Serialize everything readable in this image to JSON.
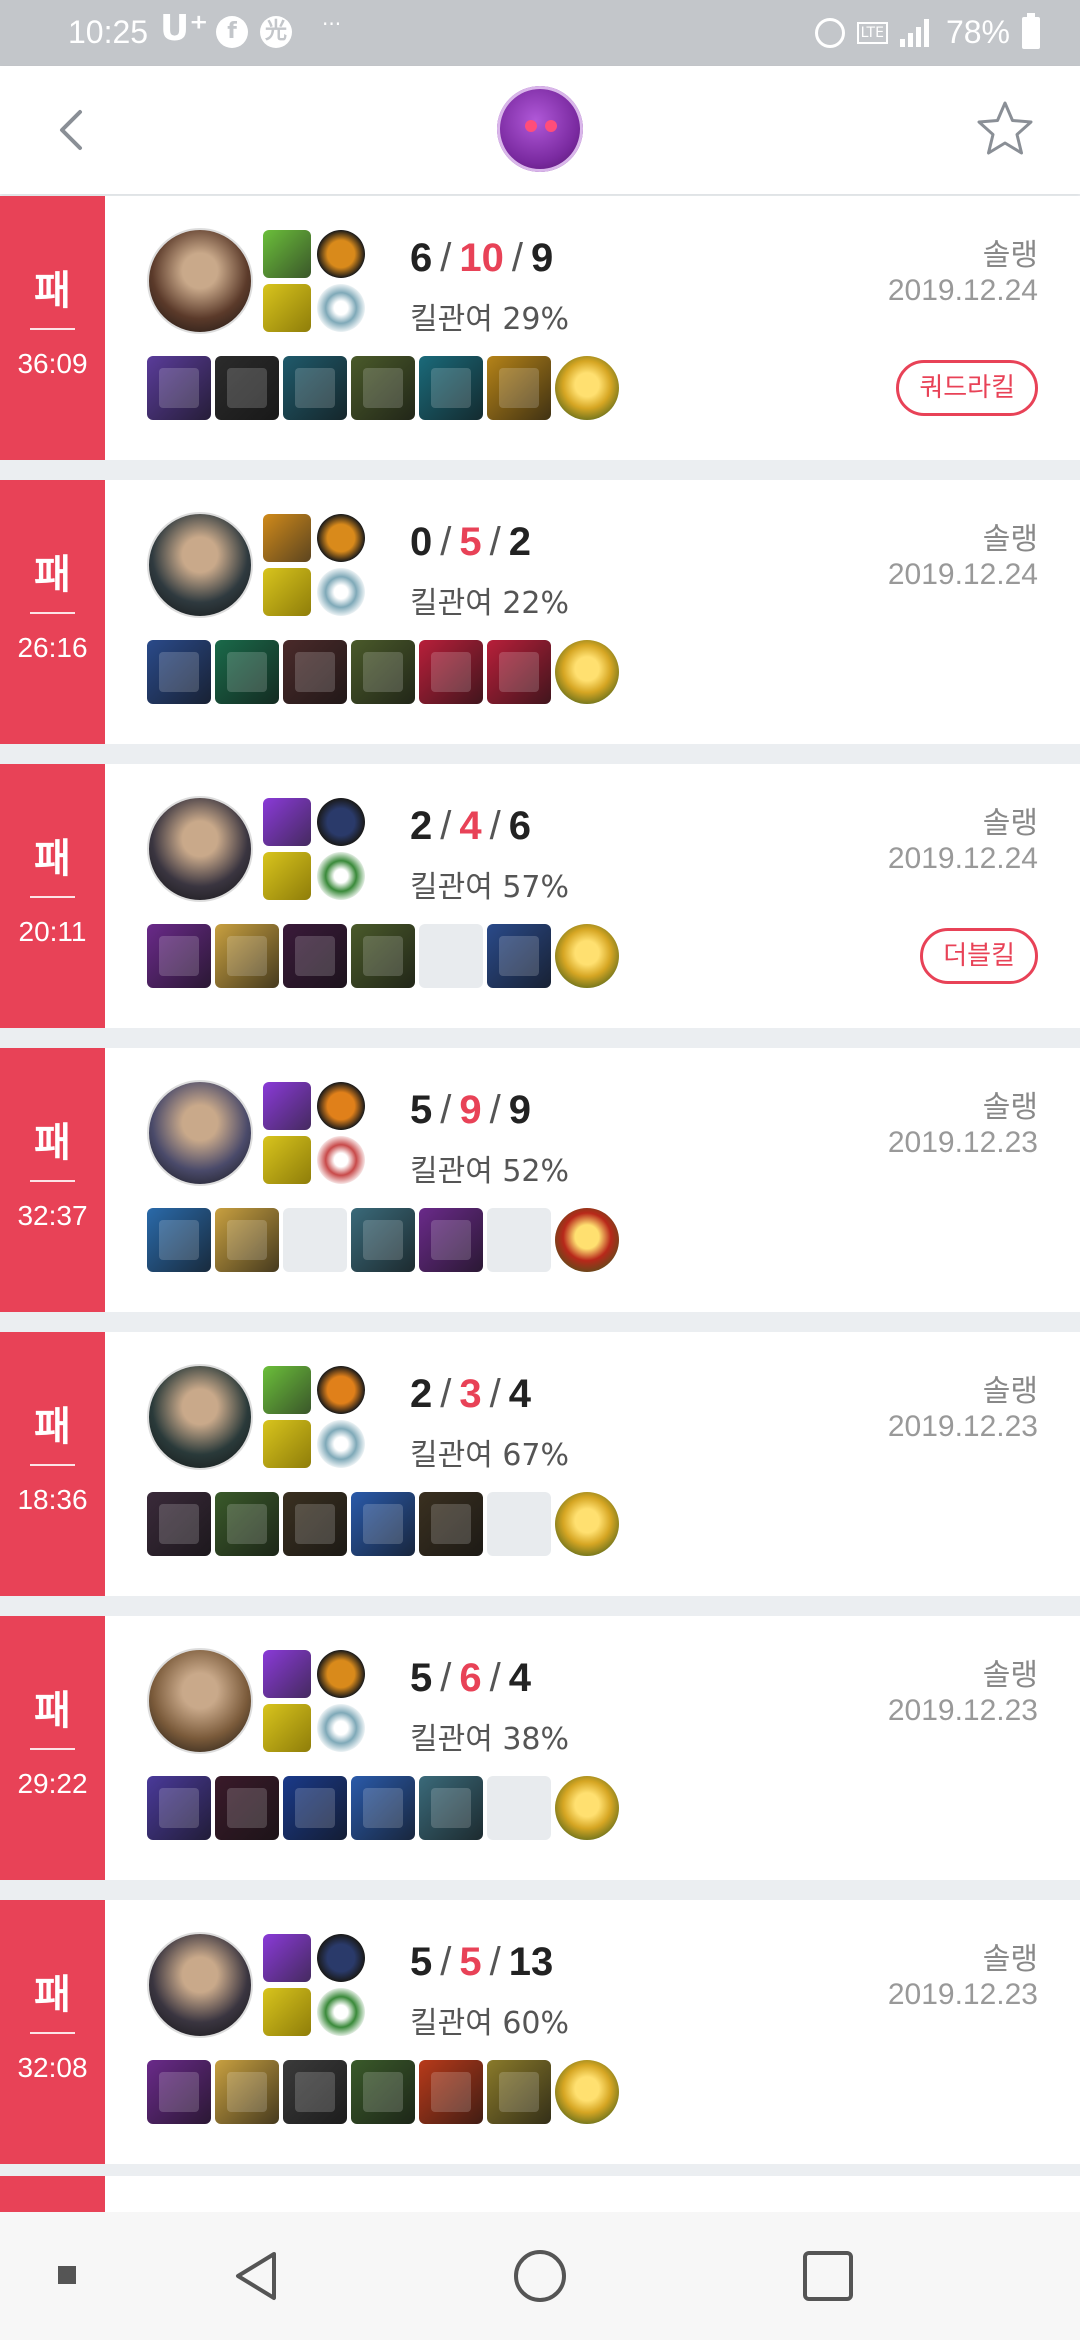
{
  "status_bar": {
    "time": "10:25",
    "carrier": "U⁺",
    "app_icons": [
      "facebook-icon",
      "app-icon"
    ],
    "battery": "78%",
    "network": "LTE"
  },
  "app_bar": {
    "back_icon": "chevron-left-icon",
    "logo_icon": "poro-logo",
    "favorite_icon": "star-outline-icon"
  },
  "colors": {
    "loss": "#e84257",
    "background": "#ebeef1"
  },
  "matches": [
    {
      "result": "패",
      "duration": "36:09",
      "kills": "6",
      "deaths": "10",
      "assists": "9",
      "kill_participation": "킬관여 29%",
      "mode": "솔랭",
      "date": "2019.12.24",
      "badge": "쿼드라킬",
      "champ_color": "#5b3a2a",
      "spell1": "#6bbf3a",
      "spell2": "#d8c41d",
      "rune1": "#d98a1b",
      "rune2": "#7fa9b8",
      "items": [
        "#5a3c9a",
        "#2b2b2b",
        "#1f5a6b",
        "#4a5a2a",
        "#1a6a7a",
        "#b58318"
      ],
      "ward": "#d6a623"
    },
    {
      "result": "패",
      "duration": "26:16",
      "kills": "0",
      "deaths": "5",
      "assists": "2",
      "kill_participation": "킬관여 22%",
      "mode": "솔랭",
      "date": "2019.12.24",
      "badge": "",
      "champ_color": "#2f3a3f",
      "spell1": "#d08a1a",
      "spell2": "#d8c41d",
      "rune1": "#d98a1b",
      "rune2": "#7fa9b8",
      "items": [
        "#2a4a8a",
        "#1a6a4a",
        "#4a2a2a",
        "#4a5a2a",
        "#b81f3a",
        "#b81f3a"
      ],
      "ward": "#d6a623"
    },
    {
      "result": "패",
      "duration": "20:11",
      "kills": "2",
      "deaths": "4",
      "assists": "6",
      "kill_participation": "킬관여 57%",
      "mode": "솔랭",
      "date": "2019.12.24",
      "badge": "더블킬",
      "champ_color": "#3a3540",
      "spell1": "#8a3ad8",
      "spell2": "#d8c41d",
      "rune1": "#2a3a6a",
      "rune2": "#3a8a3a",
      "items": [
        "#6a2a8a",
        "#c8a040",
        "#3a1a3a",
        "#4a5a2a",
        "",
        "#2a4a8a"
      ],
      "ward": "#d6a623"
    },
    {
      "result": "패",
      "duration": "32:37",
      "kills": "5",
      "deaths": "9",
      "assists": "9",
      "kill_participation": "킬관여 52%",
      "mode": "솔랭",
      "date": "2019.12.23",
      "badge": "",
      "champ_color": "#4a4a6a",
      "spell1": "#8a3ad8",
      "spell2": "#d8c41d",
      "rune1": "#e0801a",
      "rune2": "#c84a4a",
      "items": [
        "#2a6aaa",
        "#c8a040",
        "",
        "#3a6a7a",
        "#6a2a8a",
        ""
      ],
      "ward": "#b8281a"
    },
    {
      "result": "패",
      "duration": "18:36",
      "kills": "2",
      "deaths": "3",
      "assists": "4",
      "kill_participation": "킬관여 67%",
      "mode": "솔랭",
      "date": "2019.12.23",
      "badge": "",
      "champ_color": "#2a3a3a",
      "spell1": "#6bbf3a",
      "spell2": "#d8c41d",
      "rune1": "#e0801a",
      "rune2": "#7fa9b8",
      "items": [
        "#3a2a3a",
        "#3a5a2a",
        "#3a3020",
        "#2a5aaa",
        "#3a3020",
        ""
      ],
      "ward": "#d6a623"
    },
    {
      "result": "패",
      "duration": "29:22",
      "kills": "5",
      "deaths": "6",
      "assists": "4",
      "kill_participation": "킬관여 38%",
      "mode": "솔랭",
      "date": "2019.12.23",
      "badge": "",
      "champ_color": "#7a5a3a",
      "spell1": "#8a3ad8",
      "spell2": "#d8c41d",
      "rune1": "#d98a1b",
      "rune2": "#7fa9b8",
      "items": [
        "#4a3a9a",
        "#3a1a2a",
        "#1a3a8a",
        "#2a5aaa",
        "#3a6a7a",
        ""
      ],
      "ward": "#d6a623"
    },
    {
      "result": "패",
      "duration": "32:08",
      "kills": "5",
      "deaths": "5",
      "assists": "13",
      "kill_participation": "킬관여 60%",
      "mode": "솔랭",
      "date": "2019.12.23",
      "badge": "",
      "champ_color": "#3a3540",
      "spell1": "#8a3ad8",
      "spell2": "#d8c41d",
      "rune1": "#2a3a6a",
      "rune2": "#3a8a3a",
      "items": [
        "#6a2a8a",
        "#c8a040",
        "#3a3a3a",
        "#3a5a2a",
        "#b83a1a",
        "#8a7a2a"
      ],
      "ward": "#d6a623"
    }
  ]
}
